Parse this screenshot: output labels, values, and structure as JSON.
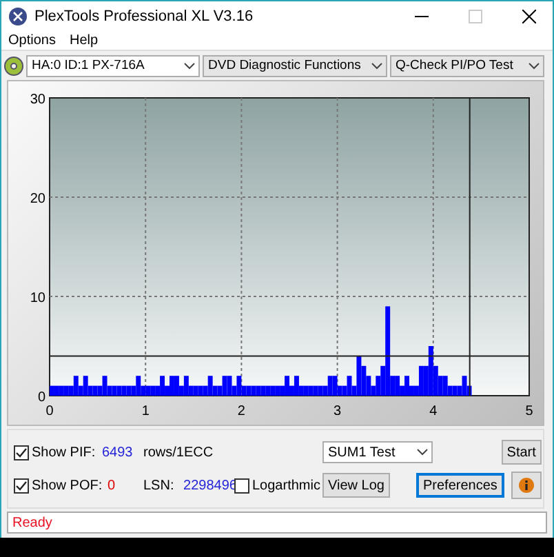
{
  "window": {
    "title": "PlexTools Professional XL V3.16"
  },
  "menu": [
    {
      "label": "Options"
    },
    {
      "label": "Help"
    }
  ],
  "toolbar": {
    "drive": "HA:0 ID:1  PX-716A",
    "function": "DVD Diagnostic Functions",
    "test": "Q-Check PI/PO Test"
  },
  "chart": {
    "chart_data": {
      "type": "bar",
      "xlim": [
        0,
        5
      ],
      "ylim": [
        0,
        30
      ],
      "xticks": [
        0,
        1,
        2,
        3,
        4,
        5
      ],
      "yticks": [
        0,
        10,
        20,
        30
      ],
      "x": [
        0,
        0.05,
        0.1,
        0.15,
        0.2,
        0.25,
        0.3,
        0.35,
        0.4,
        0.45,
        0.5,
        0.55,
        0.6,
        0.65,
        0.7,
        0.75,
        0.8,
        0.85,
        0.9,
        0.95,
        1,
        1.05,
        1.1,
        1.15,
        1.2,
        1.25,
        1.3,
        1.35,
        1.4,
        1.45,
        1.5,
        1.55,
        1.6,
        1.65,
        1.7,
        1.75,
        1.8,
        1.85,
        1.9,
        1.95,
        2,
        2.05,
        2.1,
        2.15,
        2.2,
        2.25,
        2.3,
        2.35,
        2.4,
        2.45,
        2.5,
        2.55,
        2.6,
        2.65,
        2.7,
        2.75,
        2.8,
        2.85,
        2.9,
        2.95,
        3,
        3.05,
        3.1,
        3.15,
        3.2,
        3.25,
        3.3,
        3.35,
        3.4,
        3.45,
        3.5,
        3.55,
        3.6,
        3.65,
        3.7,
        3.75,
        3.8,
        3.85,
        3.9,
        3.95,
        4,
        4.05,
        4.1,
        4.15,
        4.2,
        4.25,
        4.3,
        4.35
      ],
      "series": [
        {
          "color": "#0000ff",
          "values": [
            1,
            1,
            1,
            1,
            1,
            2,
            1,
            2,
            1,
            1,
            1,
            2,
            1,
            1,
            1,
            1,
            1,
            1,
            2,
            1,
            1,
            1,
            1,
            2,
            1,
            2,
            2,
            1,
            2,
            1,
            1,
            1,
            1,
            2,
            1,
            1,
            2,
            2,
            1,
            2,
            1,
            1,
            1,
            1,
            1,
            1,
            1,
            1,
            1,
            2,
            1,
            2,
            1,
            1,
            1,
            1,
            1,
            1,
            2,
            2,
            1,
            1,
            2,
            1,
            4,
            3,
            2,
            1,
            2,
            3,
            9,
            2,
            2,
            1,
            2,
            1,
            1,
            3,
            3,
            5,
            3,
            2,
            2,
            1,
            1,
            1,
            2,
            1
          ]
        }
      ],
      "grid": true,
      "ref_lines": [
        {
          "axis": "y",
          "value": 4
        },
        {
          "axis": "x",
          "value": 4.38
        }
      ]
    }
  },
  "controls": {
    "show_pif": {
      "label": "Show PIF:",
      "checked": true,
      "value": "6493",
      "unit": "rows/1ECC"
    },
    "show_pof": {
      "label": "Show POF:",
      "checked": true,
      "value": "0"
    },
    "lsn": {
      "label": "LSN:",
      "value": "2298496"
    },
    "logarithmic": {
      "label": "Logarthmic",
      "checked": false
    },
    "test_mode": "SUM1 Test",
    "buttons": [
      {
        "label": "Start",
        "kind": "start"
      },
      {
        "label": "View Log",
        "kind": "normal"
      },
      {
        "label": "Preferences",
        "kind": "default"
      }
    ]
  },
  "status_bar": {
    "text": "Ready"
  }
}
